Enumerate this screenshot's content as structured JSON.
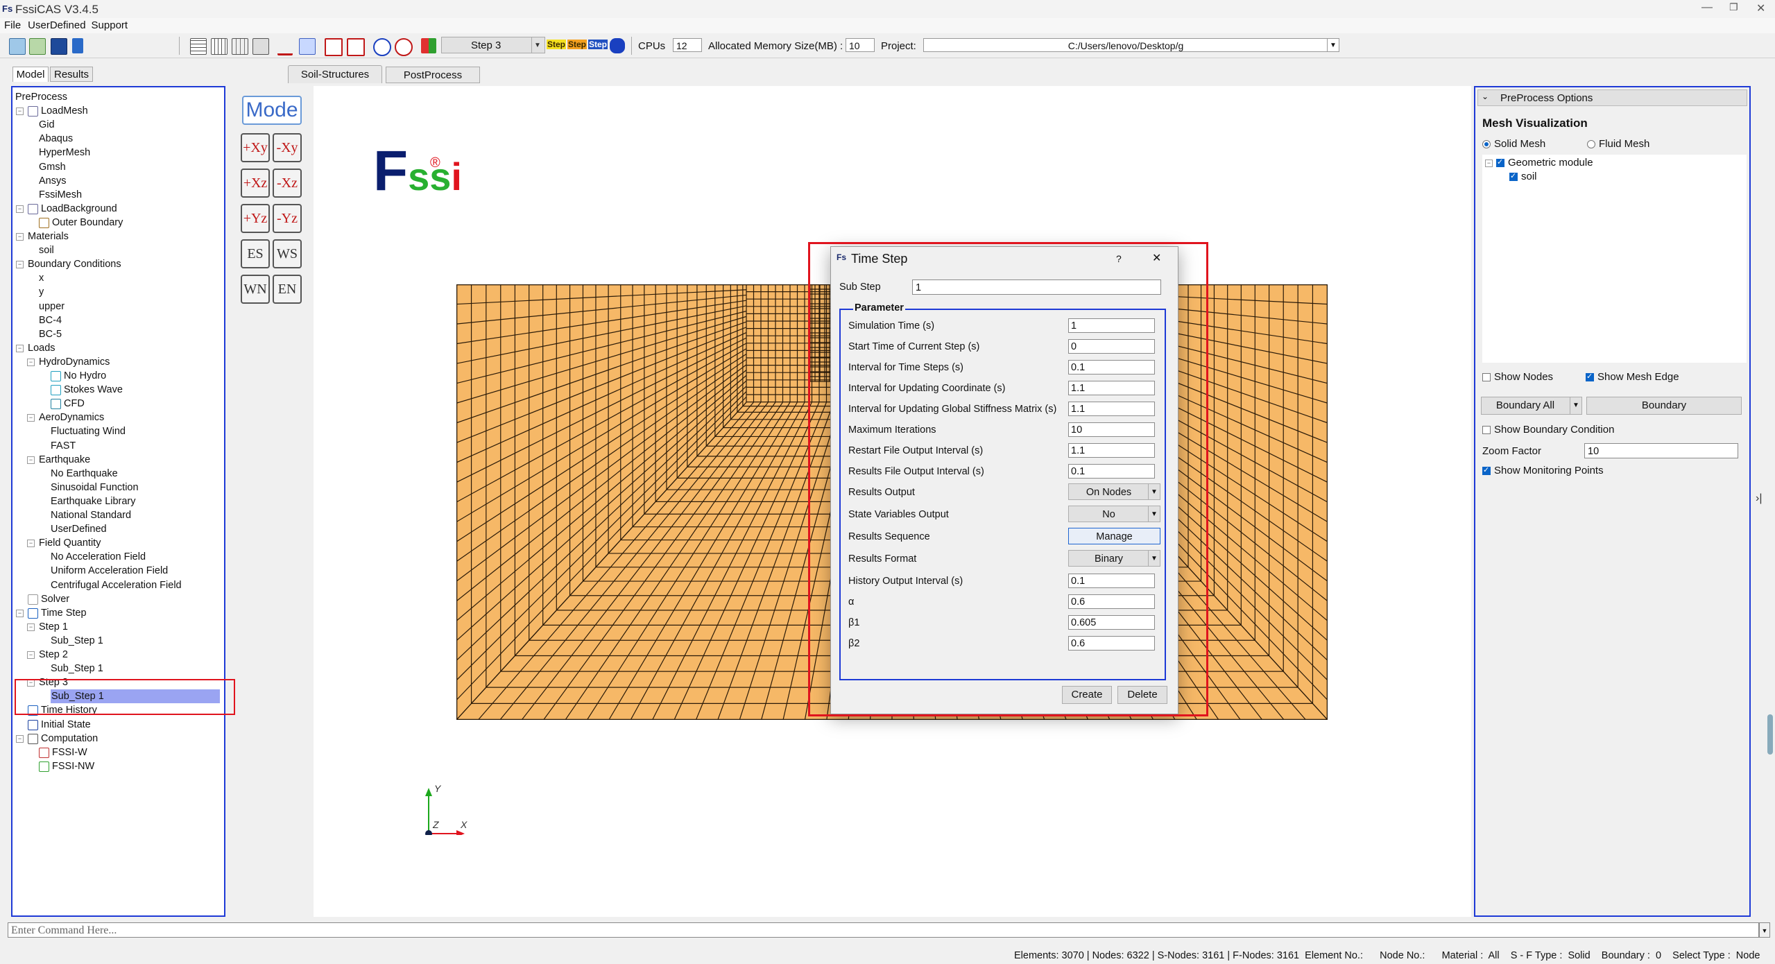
{
  "app": {
    "title": "FssiCAS V3.4.5",
    "logo_text": "Fs"
  },
  "menu": [
    "File",
    "UserDefined",
    "Support"
  ],
  "toolbar": {
    "step_combo": "Step 3",
    "step_btn_1": "Step",
    "step_btn_2": "Step",
    "step_btn_3": "Step",
    "cpus_label": "CPUs",
    "cpus_value": "12",
    "memory_label": "Allocated Memory Size(MB) :",
    "memory_value": "10",
    "project_label": "Project:",
    "project_value": "C:/Users/lenovo/Desktop/g"
  },
  "left_tabs": [
    "Model",
    "Results"
  ],
  "tree": [
    {
      "label": "PreProcess",
      "level": 0
    },
    {
      "label": "LoadMesh",
      "level": 1
    },
    {
      "label": "Gid",
      "level": 2
    },
    {
      "label": "Abaqus",
      "level": 2
    },
    {
      "label": "HyperMesh",
      "level": 2
    },
    {
      "label": "Gmsh",
      "level": 2
    },
    {
      "label": "Ansys",
      "level": 2
    },
    {
      "label": "FssiMesh",
      "level": 2
    },
    {
      "label": "LoadBackground",
      "level": 1
    },
    {
      "label": "Outer Boundary",
      "level": 2
    },
    {
      "label": "Materials",
      "level": 1
    },
    {
      "label": "soil",
      "level": 2
    },
    {
      "label": "Boundary Conditions",
      "level": 1
    },
    {
      "label": "x",
      "level": 2
    },
    {
      "label": "y",
      "level": 2
    },
    {
      "label": "upper",
      "level": 2
    },
    {
      "label": "BC-4",
      "level": 2
    },
    {
      "label": "BC-5",
      "level": 2
    },
    {
      "label": "Loads",
      "level": 1
    },
    {
      "label": "HydroDynamics",
      "level": 2
    },
    {
      "label": "No Hydro",
      "level": 3
    },
    {
      "label": "Stokes Wave",
      "level": 3
    },
    {
      "label": "CFD",
      "level": 3
    },
    {
      "label": "AeroDynamics",
      "level": 2
    },
    {
      "label": "Fluctuating Wind",
      "level": 3
    },
    {
      "label": "FAST",
      "level": 3
    },
    {
      "label": "Earthquake",
      "level": 2
    },
    {
      "label": "No Earthquake",
      "level": 3
    },
    {
      "label": "Sinusoidal Function",
      "level": 3
    },
    {
      "label": "Earthquake Library",
      "level": 3
    },
    {
      "label": "National Standard",
      "level": 3
    },
    {
      "label": "UserDefined",
      "level": 3
    },
    {
      "label": "Field Quantity",
      "level": 2
    },
    {
      "label": "No Acceleration Field",
      "level": 3
    },
    {
      "label": "Uniform Acceleration Field",
      "level": 3
    },
    {
      "label": "Centrifugal Acceleration Field",
      "level": 3
    },
    {
      "label": "Solver",
      "level": 1
    },
    {
      "label": "Time Step",
      "level": 1
    },
    {
      "label": "Step 1",
      "level": 2
    },
    {
      "label": "Sub_Step 1",
      "level": 3
    },
    {
      "label": "Step 2",
      "level": 2
    },
    {
      "label": "Sub_Step 1",
      "level": 3
    },
    {
      "label": "Step 3",
      "level": 2
    },
    {
      "label": "Sub_Step 1",
      "level": 3,
      "selected": true
    },
    {
      "label": "Time History",
      "level": 1
    },
    {
      "label": "Initial State",
      "level": 1
    },
    {
      "label": "Computation",
      "level": 1
    },
    {
      "label": "FSSI-W",
      "level": 2
    },
    {
      "label": "FSSI-NW",
      "level": 2
    }
  ],
  "center_tabs": [
    "Soil-Structures",
    "PostProcess"
  ],
  "view_buttons": {
    "mode": "Mode",
    "buttons": [
      "+Xy",
      "-Xy",
      "+Xz",
      "-Xz",
      "+Yz",
      "-Yz",
      "ES",
      "WS",
      "WN",
      "EN"
    ]
  },
  "logo": {
    "text_f": "F",
    "text_ss": "ss",
    "text_i": "i",
    "reg": "®"
  },
  "axes": {
    "y": "Y",
    "x": "X",
    "z": "Z"
  },
  "dialog": {
    "title": "Time Step",
    "help": "?",
    "close": "✕",
    "sub_step_label": "Sub Step",
    "sub_step_value": "1",
    "group_title": "Parameter",
    "fields": [
      {
        "label": "Simulation Time (s)",
        "value": "1",
        "kind": "input"
      },
      {
        "label": "Start Time of Current Step (s)",
        "value": "0",
        "kind": "input"
      },
      {
        "label": "Interval for Time Steps (s)",
        "value": "0.1",
        "kind": "input"
      },
      {
        "label": "Interval for Updating Coordinate (s)",
        "value": "1.1",
        "kind": "input"
      },
      {
        "label": "Interval for Updating Global Stiffness Matrix (s)",
        "value": "1.1",
        "kind": "input"
      },
      {
        "label": "Maximum Iterations",
        "value": "10",
        "kind": "input"
      },
      {
        "label": "Restart File Output Interval (s)",
        "value": "1.1",
        "kind": "input"
      },
      {
        "label": "Results File Output Interval (s)",
        "value": "0.1",
        "kind": "input"
      },
      {
        "label": "Results Output",
        "value": "On Nodes",
        "kind": "combo"
      },
      {
        "label": "State Variables Output",
        "value": "No",
        "kind": "combo"
      },
      {
        "label": "Results Sequence",
        "value": "Manage",
        "kind": "button"
      },
      {
        "label": "Results Format",
        "value": "Binary",
        "kind": "combo"
      },
      {
        "label": "History Output Interval (s)",
        "value": "0.1",
        "kind": "input"
      },
      {
        "label": "α",
        "value": "0.6",
        "kind": "input"
      },
      {
        "label": "β1",
        "value": "0.605",
        "kind": "input"
      },
      {
        "label": "β2",
        "value": "0.6",
        "kind": "input"
      }
    ],
    "create_btn": "Create",
    "delete_btn": "Delete"
  },
  "right_panel": {
    "header": "PreProcess Options",
    "section_title": "Mesh Visualization",
    "radio_solid": "Solid Mesh",
    "radio_fluid": "Fluid Mesh",
    "tree_root": "Geometric module",
    "tree_child": "soil",
    "show_nodes": "Show Nodes",
    "show_mesh_edge": "Show Mesh Edge",
    "boundary_combo": "Boundary All",
    "boundary_btn": "Boundary",
    "show_boundary_condition": "Show Boundary Condition",
    "zoom_label": "Zoom Factor",
    "zoom_value": "10",
    "show_monitoring": "Show Monitoring Points"
  },
  "command": {
    "placeholder": "Enter Command Here..."
  },
  "status": {
    "text": "Elements: 3070 | Nodes: 6322 | S-Nodes: 3161 | F-Nodes: 3161  Element No.:      Node No.:      Material :  All    S - F Type :  Solid    Boundary :  0    Select Type :  Node"
  },
  "colors": {
    "mesh_fill": "#f6b867",
    "mesh_line": "#2a1a08",
    "highlight_red": "#e0141e",
    "panel_border": "#1e3ad6",
    "selection": "#9aa4f2"
  }
}
